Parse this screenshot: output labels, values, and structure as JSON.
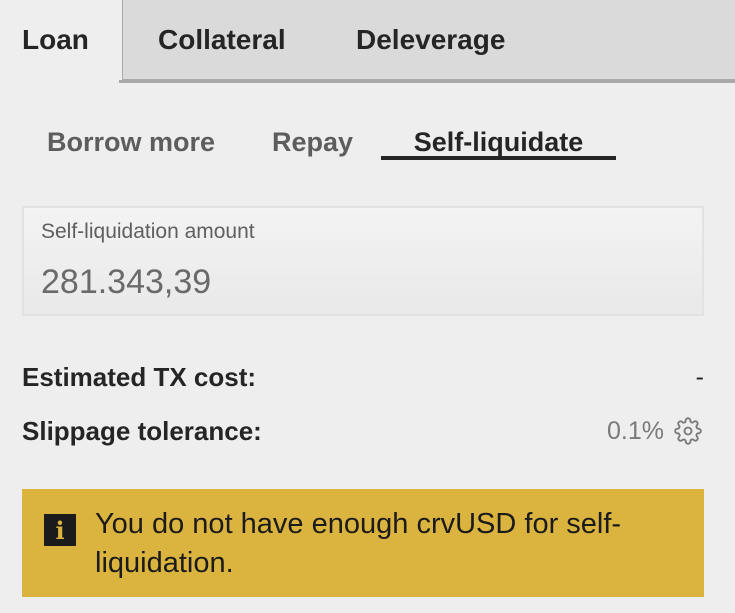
{
  "top_tabs": [
    {
      "label": "Loan",
      "active": true
    },
    {
      "label": "Collateral",
      "active": false
    },
    {
      "label": "Deleverage",
      "active": false
    }
  ],
  "sub_tabs": [
    {
      "label": "Borrow more",
      "active": false
    },
    {
      "label": "Repay",
      "active": false
    },
    {
      "label": "Self-liquidate",
      "active": true
    }
  ],
  "amount_input": {
    "label": "Self-liquidation amount",
    "value": "281.343,39"
  },
  "details": {
    "tx_cost_label": "Estimated TX cost:",
    "tx_cost_value": "-",
    "slippage_label": "Slippage tolerance:",
    "slippage_value": "0.1%",
    "slippage_icon": "gear-icon"
  },
  "alert": {
    "icon": "info-icon",
    "icon_glyph": "i",
    "message": "You do not have enough crvUSD for self-liquidation.",
    "color": "#dbb43f"
  },
  "colors": {
    "background": "#eeeeee",
    "inactive_tab_bg": "#dadada",
    "text": "#252525"
  }
}
